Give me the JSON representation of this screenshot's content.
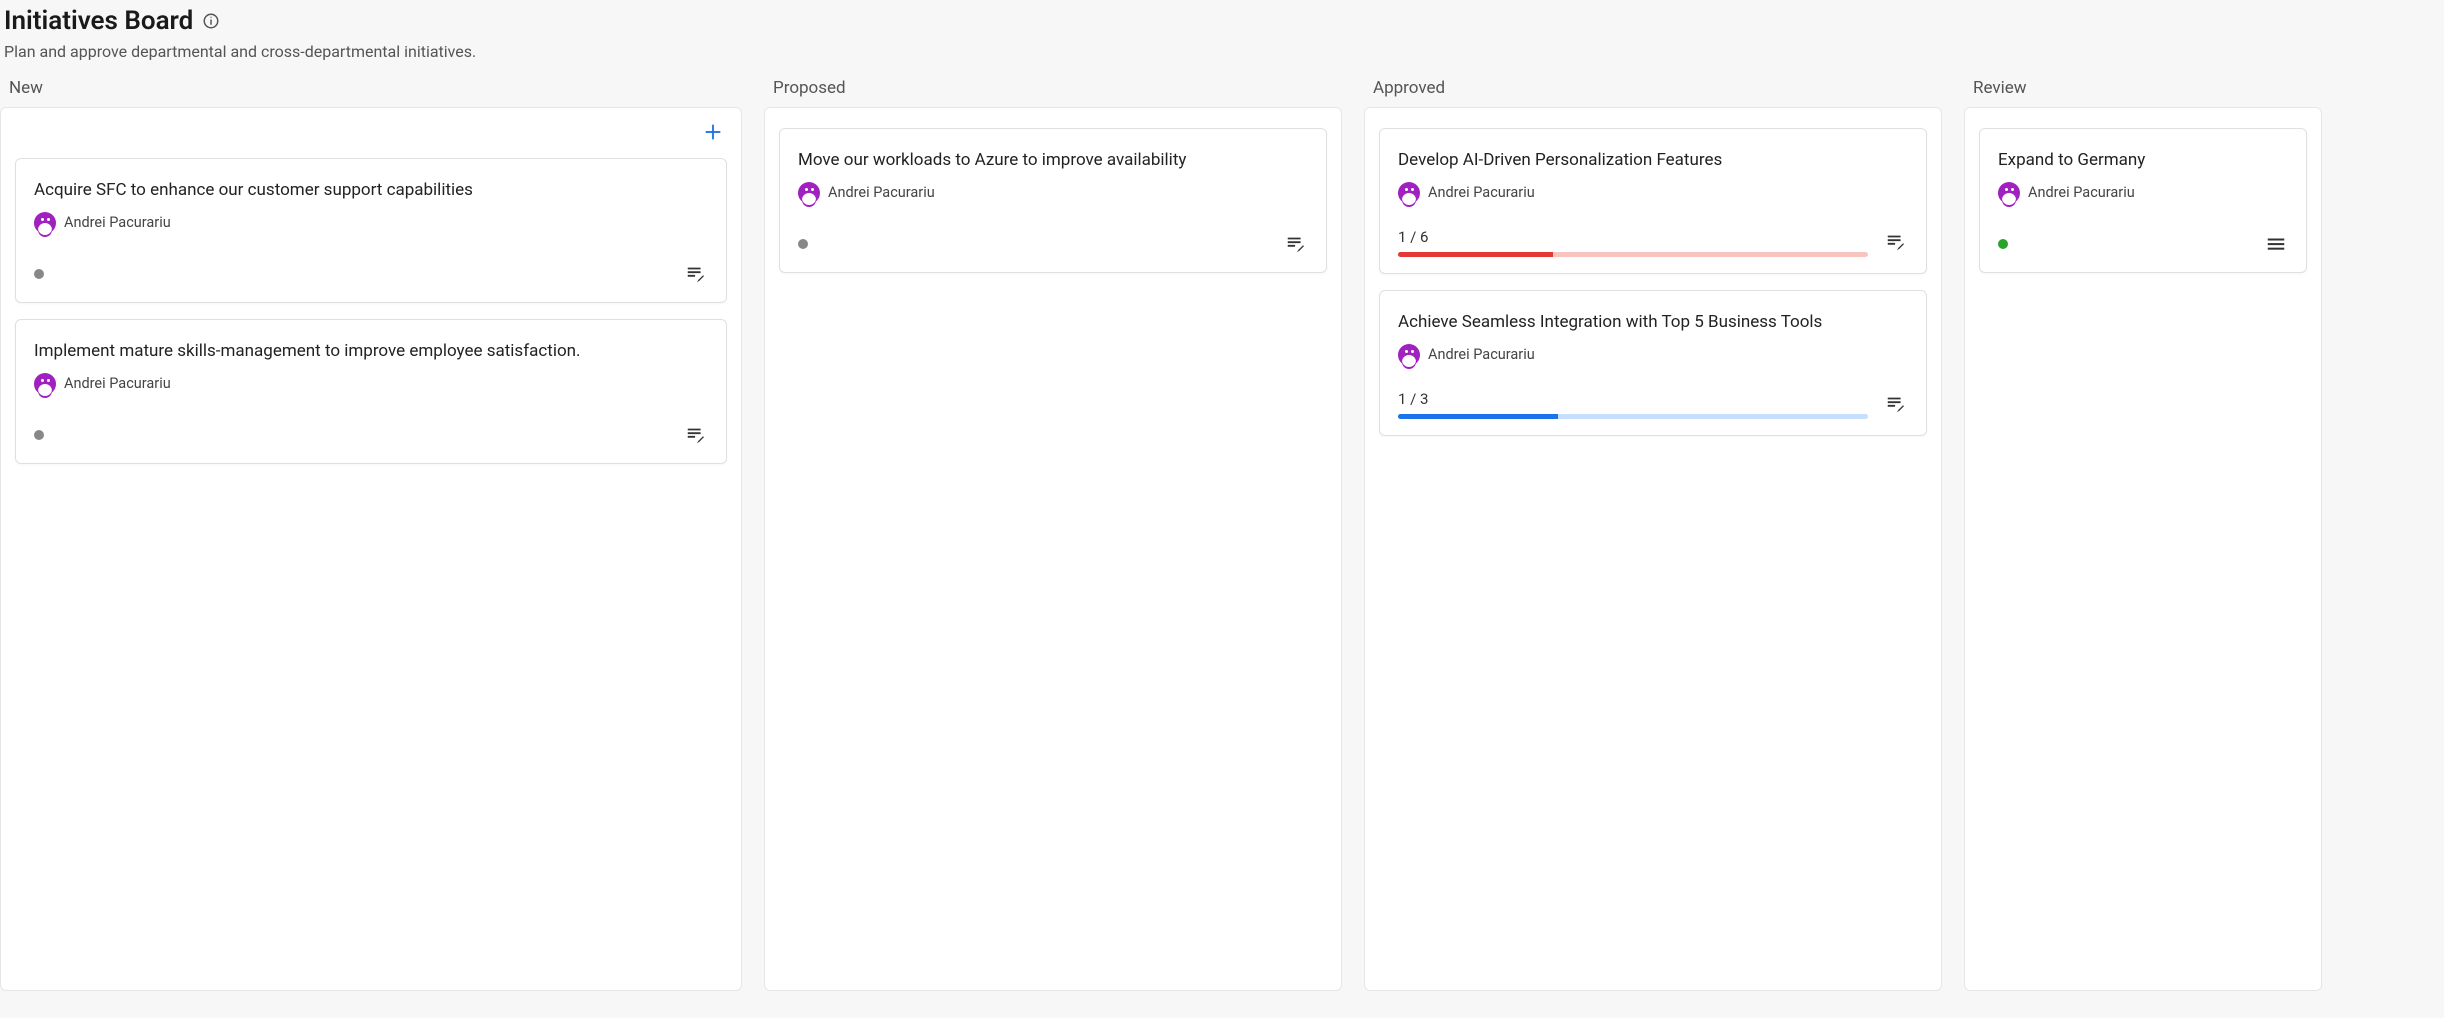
{
  "header": {
    "title": "Initiatives Board",
    "subtitle": "Plan and approve departmental and cross-departmental initiatives."
  },
  "owner": "Andrei Pacurariu",
  "columns": [
    {
      "id": "new",
      "title": "New",
      "has_add": true,
      "width": "wide",
      "cards": [
        {
          "title": "Acquire SFC to enhance our customer support capabilities",
          "owner": "Andrei Pacurariu",
          "status_color": "grey",
          "footer_icon": "edit"
        },
        {
          "title": "Implement mature skills-management to improve employee satisfaction.",
          "owner": "Andrei Pacurariu",
          "status_color": "grey",
          "footer_icon": "edit"
        }
      ]
    },
    {
      "id": "proposed",
      "title": "Proposed",
      "has_add": false,
      "width": "med",
      "cards": [
        {
          "title": "Move our workloads to Azure to improve availability",
          "owner": "Andrei Pacurariu",
          "status_color": "grey",
          "footer_icon": "edit"
        }
      ]
    },
    {
      "id": "approved",
      "title": "Approved",
      "has_add": false,
      "width": "med",
      "cards": [
        {
          "title": "Develop AI-Driven Personalization Features",
          "owner": "Andrei Pacurariu",
          "progress": {
            "label": "1 / 6",
            "pct": 33,
            "color": "red"
          },
          "footer_icon": "edit"
        },
        {
          "title": "Achieve Seamless Integration with Top 5 Business Tools",
          "owner": "Andrei Pacurariu",
          "progress": {
            "label": "1 / 3",
            "pct": 34,
            "color": "blue"
          },
          "footer_icon": "edit"
        }
      ]
    },
    {
      "id": "review",
      "title": "Review",
      "has_add": false,
      "width": "narrow",
      "cards": [
        {
          "title": "Expand to Germany",
          "owner": "Andrei Pacurariu",
          "status_color": "green",
          "footer_icon": "menu"
        }
      ]
    }
  ]
}
